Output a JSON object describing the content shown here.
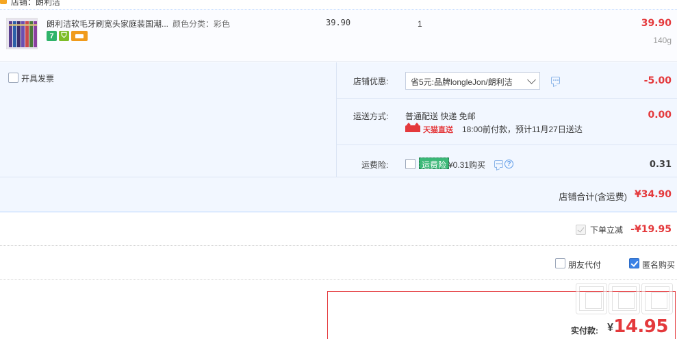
{
  "header": {
    "shop_title_cutoff": "店铺：朗利洁"
  },
  "item": {
    "title": "朗利洁软毛牙刷宽头家庭装国潮...",
    "sku": "颜色分类：彩色",
    "badges": [
      "7",
      "shield",
      "card"
    ],
    "unit_price": "39.90",
    "quantity": "1",
    "subtotal": "39.90",
    "weight": "140g"
  },
  "options": {
    "invoice_label": "开具发票",
    "shop_discount": {
      "label": "店铺优惠:",
      "selected": "省5元:品牌longleJon/朗利洁",
      "amount": "-5.00"
    },
    "shipping": {
      "label": "运送方式:",
      "method": "普通配送 快递 免邮",
      "tmall_label": "天猫直送",
      "eta": "18:00前付款，预计11月27日送达",
      "amount": "0.00"
    },
    "insurance": {
      "label": "运费险:",
      "tag": "运费险",
      "price_text": "¥0.31购买",
      "amount": "0.31"
    },
    "shop_total": {
      "label": "店铺合计(含运费)",
      "value": "¥34.90"
    }
  },
  "discount": {
    "label": "下单立减",
    "value": "-¥19.95"
  },
  "buyer_options": {
    "friend_label": "朋友代付",
    "anonymous_label": "匿名购买"
  },
  "payment": {
    "label": "实付款:",
    "currency": "¥",
    "value": "14.95"
  },
  "colors": {
    "accent_red": "#e4393c",
    "panel_blue": "#f2f7ff",
    "checkbox_blue": "#3b82e6",
    "insurance_green": "#3cb878"
  }
}
